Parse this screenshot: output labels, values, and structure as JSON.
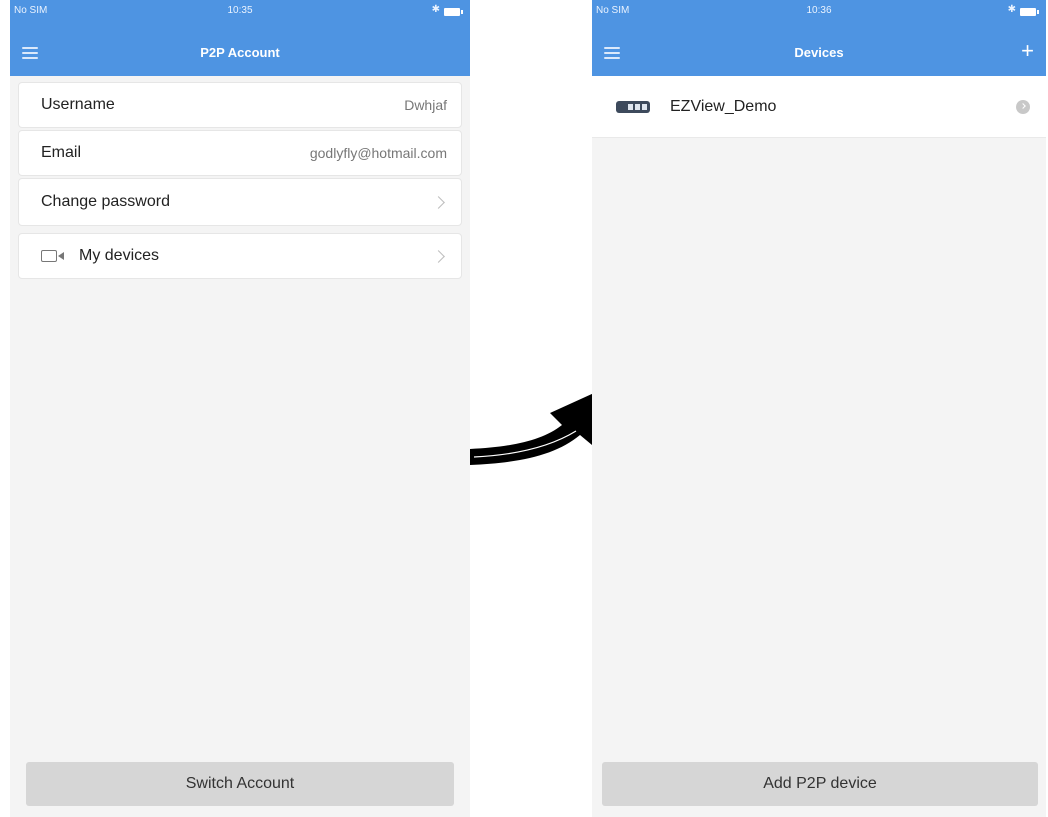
{
  "left_screen": {
    "status_bar": {
      "carrier": "No SIM",
      "time": "10:35",
      "bluetooth": "✱"
    },
    "header": {
      "title": "P2P Account",
      "menu_icon": "hamburger-menu-icon"
    },
    "rows": [
      {
        "label": "Username",
        "value": "Dwhjaf"
      },
      {
        "label": "Email",
        "value": "godlyfly@hotmail.com"
      },
      {
        "label": "Change password",
        "value": ""
      },
      {
        "label": "My devices",
        "value": ""
      }
    ],
    "bottom_button": "Switch Account"
  },
  "right_screen": {
    "status_bar": {
      "carrier": "No SIM",
      "time": "10:36",
      "bluetooth": "✱"
    },
    "header": {
      "title": "Devices",
      "menu_icon": "hamburger-menu-icon",
      "add_icon": "+"
    },
    "device": {
      "name": "EZView_Demo",
      "icon": "dvr-device-icon"
    },
    "bottom_button": "Add P2P device"
  },
  "colors": {
    "header_blue": "#4e94e2",
    "background": "#f4f4f4",
    "button_gray": "#d6d6d6",
    "arrow": "#000000"
  }
}
